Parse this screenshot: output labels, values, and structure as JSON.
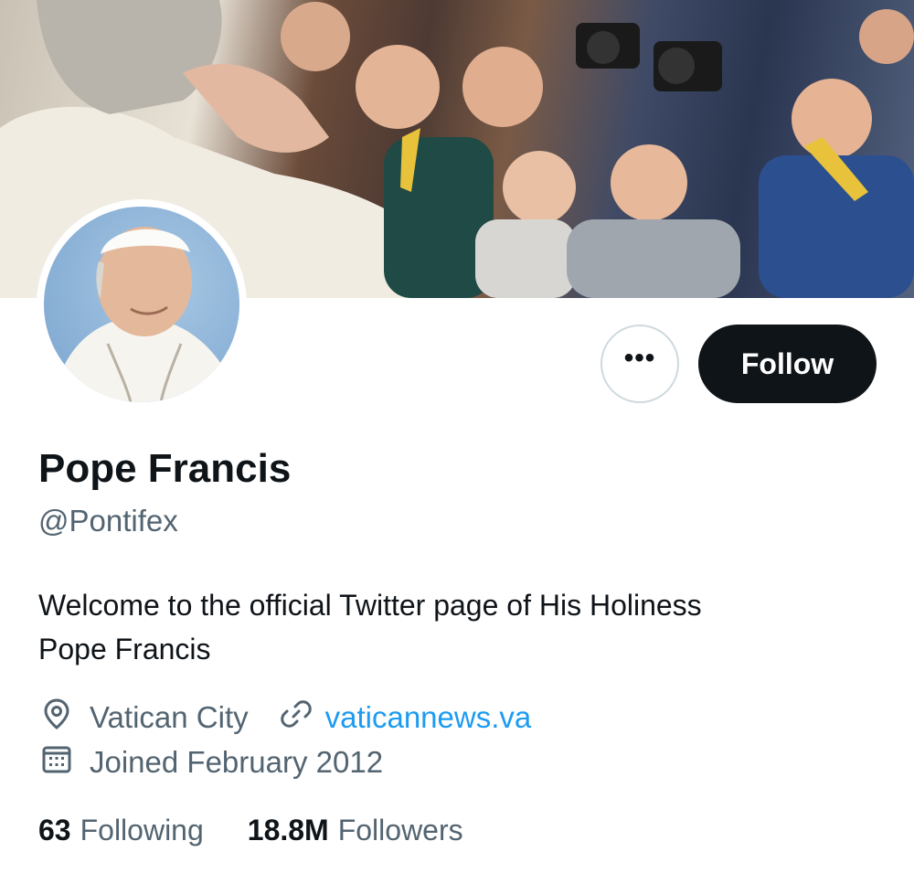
{
  "profile": {
    "name": "Pope Francis",
    "handle": "@Pontifex",
    "bio_line1": "Welcome to the official Twitter page of His Holiness",
    "bio_line2": "Pope Francis",
    "location": "Vatican City",
    "website": "vaticannews.va",
    "joined": "Joined February 2012"
  },
  "actions": {
    "more_label": "•••",
    "follow_label": "Follow"
  },
  "stats": {
    "following_count": "63",
    "following_label": "Following",
    "followers_count": "18.8M",
    "followers_label": "Followers"
  },
  "colors": {
    "text_primary": "#0f1419",
    "text_secondary": "#536471",
    "link": "#1d9bf0",
    "follow_bg": "#0f1419"
  },
  "icons": {
    "location": "location-pin-icon",
    "website": "link-icon",
    "joined": "calendar-icon"
  }
}
